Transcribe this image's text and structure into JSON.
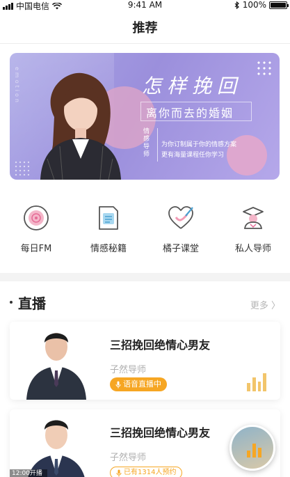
{
  "status_bar": {
    "carrier": "中国电信",
    "time": "9:41 AM",
    "battery": "100%",
    "battery_level": 1.0
  },
  "nav": {
    "title": "推荐"
  },
  "banner": {
    "headline": "怎样挽回",
    "subheadline": "离你而去的婚姻",
    "tag": "情感导师",
    "desc_line1": "为你订制属于你的情感方案",
    "desc_line2": "更有海量课程任你学习",
    "vertical_text": "emotion",
    "colors": {
      "bg": "#a9a6e6",
      "accent_circle": "#d9a3c9"
    }
  },
  "quick_nav": [
    {
      "label": "每日FM",
      "icon": "disc-icon"
    },
    {
      "label": "情感秘籍",
      "icon": "document-icon"
    },
    {
      "label": "橘子课堂",
      "icon": "heart-pen-icon"
    },
    {
      "label": "私人导师",
      "icon": "graduate-icon"
    }
  ],
  "live_section": {
    "title": "直播",
    "more": "更多 〉",
    "cards": [
      {
        "title": "三招挽回绝情心男友",
        "teacher": "子然导师",
        "status": "语音直播中",
        "status_style": "filled"
      },
      {
        "title": "三招挽回绝情心男友",
        "teacher": "子然导师",
        "status": "已有1314人预约",
        "status_style": "outline",
        "time": "12:00开播"
      }
    ]
  },
  "colors": {
    "accent": "#f6a623",
    "muted": "#b0b0b0"
  }
}
